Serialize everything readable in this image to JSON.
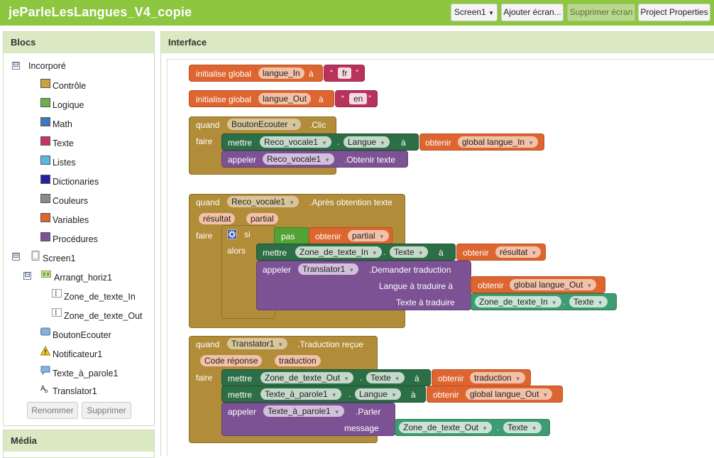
{
  "app": {
    "title": "jeParleLesLangues_V4_copie",
    "screen_select": "Screen1",
    "add_screen": "Ajouter écran...",
    "remove_screen": "Supprimer écran",
    "project_properties": "Project Properties"
  },
  "palette": {
    "header": "Blocs",
    "builtin": "Incorporé",
    "builtin_toggle": "⊟",
    "screen_toggle": "⊟",
    "arr_toggle": "⊟",
    "categories": [
      {
        "label": "Contrôle",
        "color": "#c9a23c"
      },
      {
        "label": "Logique",
        "color": "#6fb04a"
      },
      {
        "label": "Math",
        "color": "#3c78c0"
      },
      {
        "label": "Texte",
        "color": "#c5365e"
      },
      {
        "label": "Listes",
        "color": "#58b7e0"
      },
      {
        "label": "Dictionaries",
        "color": "#2a1fa0"
      },
      {
        "label": "Couleurs",
        "color": "#8a8a8a"
      },
      {
        "label": "Variables",
        "color": "#dd6530"
      },
      {
        "label": "Procédures",
        "color": "#7d5294"
      }
    ],
    "components": {
      "screen": "Screen1",
      "arrangement": "Arrangt_horiz1",
      "textbox_in": "Zone_de_texte_In",
      "textbox_out": "Zone_de_texte_Out",
      "button": "BoutonEcouter",
      "notifier": "Notificateur1",
      "tts": "Texte_à_parole1",
      "translator": "Translator1"
    },
    "rename_button": "Renommer",
    "delete_button": "Supprimer",
    "media_header": "Média"
  },
  "workspace": {
    "header": "Interface",
    "var1": {
      "init": "initialise global",
      "name": "langue_In",
      "to": "à",
      "value": "fr"
    },
    "var2": {
      "init": "initialise global",
      "name": "langue_Out",
      "to": "à",
      "value": "en"
    },
    "event1": {
      "when": "quand",
      "component": "BoutonEcouter",
      "event": ".Clic",
      "do": "faire",
      "set_kw": "mettre",
      "set_comp": "Reco_vocale1",
      "set_prop": "Langue",
      "to": "à",
      "get_kw": "obtenir",
      "get_var": "global langue_In",
      "call_kw": "appeler",
      "call_comp": "Reco_vocale1",
      "call_method": ".Obtenir texte"
    },
    "event2": {
      "when": "quand",
      "component": "Reco_vocale1",
      "event": ".Après obtention texte",
      "param1": "résultat",
      "param2": "partial",
      "do": "faire",
      "if_kw": "si",
      "not_kw": "pas",
      "get_kw": "obtenir",
      "get_partial": "partial",
      "then_kw": "alors",
      "set_kw": "mettre",
      "set_comp": "Zone_de_texte_In",
      "dot": ".",
      "set_prop": "Texte",
      "to": "à",
      "get_result": "résultat",
      "call_kw": "appeler",
      "call_comp": "Translator1",
      "call_method": ".Demander traduction",
      "arg1_label": "Langue à traduire à",
      "arg1_get_kw": "obtenir",
      "arg1_var": "global langue_Out",
      "arg2_label": "Texte à traduire",
      "arg2_comp": "Zone_de_texte_In",
      "arg2_prop": "Texte"
    },
    "event3": {
      "when": "quand",
      "component": "Translator1",
      "event": ".Traduction reçue",
      "param1": "Code réponse",
      "param2": "traduction",
      "do": "faire",
      "set1_kw": "mettre",
      "set1_comp": "Zone_de_texte_Out",
      "set1_prop": "Texte",
      "to": "à",
      "get1_kw": "obtenir",
      "get1_var": "traduction",
      "set2_kw": "mettre",
      "set2_comp": "Texte_à_parole1",
      "set2_prop": "Langue",
      "get2_kw": "obtenir",
      "get2_var": "global langue_Out",
      "call_kw": "appeler",
      "call_comp": "Texte_à_parole1",
      "call_method": ".Parler",
      "arg_label": "message",
      "arg_comp": "Zone_de_texte_Out",
      "arg_prop": "Texte"
    }
  }
}
